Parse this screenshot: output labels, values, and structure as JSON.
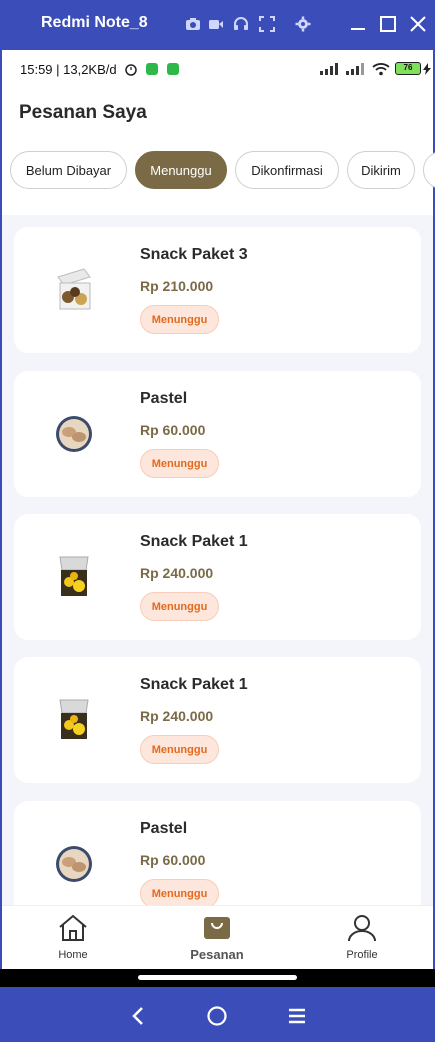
{
  "window": {
    "title": "Redmi Note_8",
    "toolbar_icons": [
      "camera-icon",
      "video-icon",
      "headphones-icon",
      "fullscreen-icon",
      "gear-icon"
    ],
    "controls": [
      "minimize-icon",
      "maximize-icon",
      "close-icon"
    ],
    "accent": "#3a4db8"
  },
  "status_bar": {
    "time": "15:59 | 13,2KB/d",
    "battery": "76"
  },
  "header": {
    "title": "Pesanan Saya"
  },
  "tabs": [
    {
      "label": "Belum Dibayar",
      "active": false
    },
    {
      "label": "Menunggu",
      "active": true
    },
    {
      "label": "Dikonfirmasi",
      "active": false
    },
    {
      "label": "Dikirim",
      "active": false
    }
  ],
  "orders": [
    {
      "name": "Snack Paket 3",
      "price": "Rp 210.000",
      "status": "Menunggu",
      "image": "snack-box-image"
    },
    {
      "name": "Pastel",
      "price": "Rp 60.000",
      "status": "Menunggu",
      "image": "pastel-plate-image"
    },
    {
      "name": "Snack Paket 1",
      "price": "Rp 240.000",
      "status": "Menunggu",
      "image": "snack-box-image"
    },
    {
      "name": "Snack Paket 1",
      "price": "Rp 240.000",
      "status": "Menunggu",
      "image": "snack-box-image"
    },
    {
      "name": "Pastel",
      "price": "Rp 60.000",
      "status": "Menunggu",
      "image": "pastel-plate-image"
    }
  ],
  "bottom_nav": {
    "home": "Home",
    "orders": "Pesanan",
    "profile": "Profile"
  },
  "colors": {
    "brand": "#7a6a45",
    "status_badge_bg": "#fde6dc",
    "status_badge_text": "#e36a1c"
  }
}
